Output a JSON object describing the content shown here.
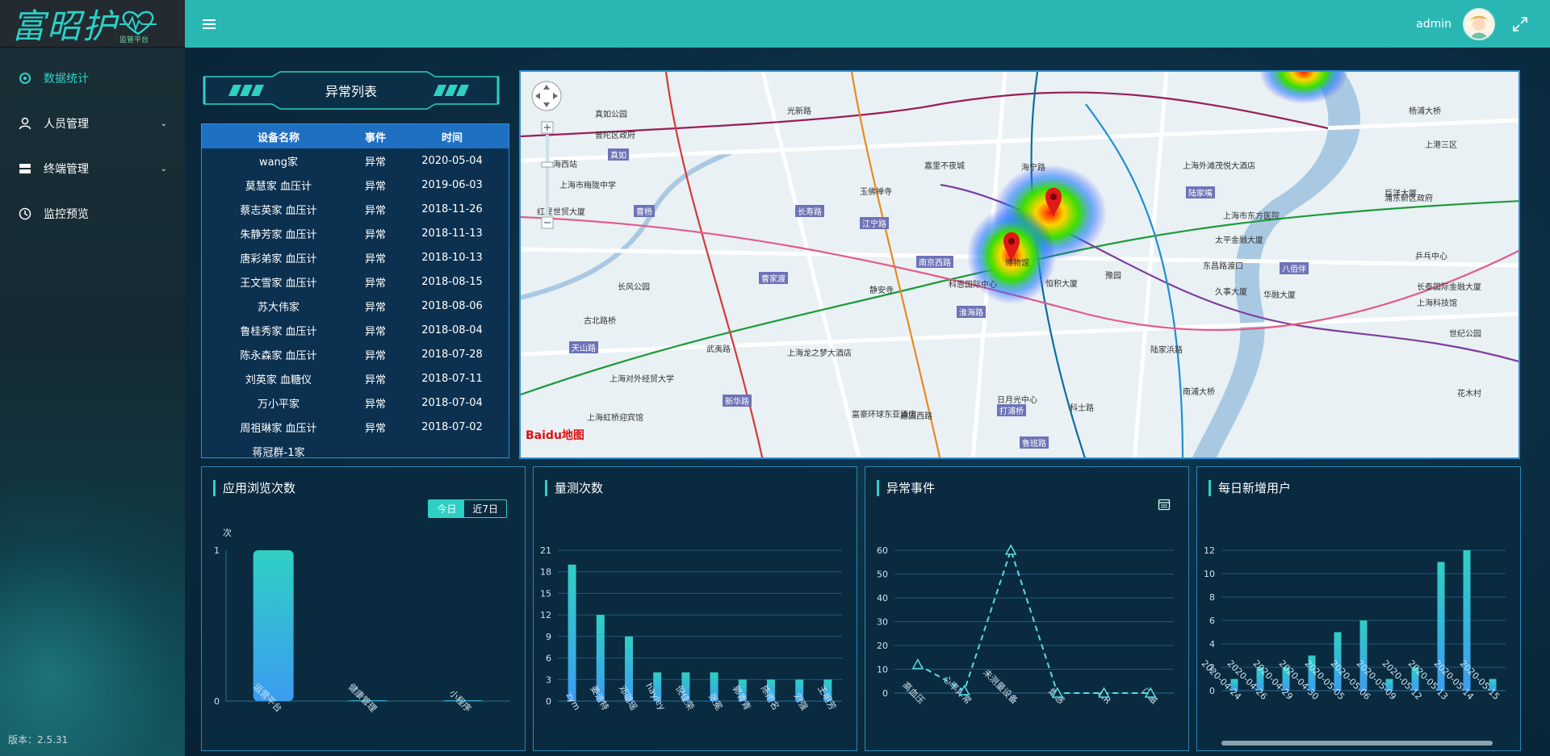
{
  "app": {
    "logo_text": "富昭护",
    "logo_sub": "监管平台",
    "version": "版本：2.5.31"
  },
  "sidebar": {
    "items": [
      {
        "label": "数据统计",
        "icon": "dashboard-icon",
        "active": true
      },
      {
        "label": "人员管理",
        "icon": "user-icon",
        "expandable": true
      },
      {
        "label": "终端管理",
        "icon": "device-icon",
        "expandable": true
      },
      {
        "label": "监控预览",
        "icon": "clock-icon"
      }
    ]
  },
  "header": {
    "username": "admin"
  },
  "abnormal_list": {
    "title": "异常列表",
    "columns": [
      "设备名称",
      "事件",
      "时间"
    ],
    "rows": [
      {
        "name": "wang家",
        "event": "异常",
        "time": "2020-05-04"
      },
      {
        "name": "莫慧家 血压计",
        "event": "异常",
        "time": "2019-06-03"
      },
      {
        "name": "蔡志英家 血压计",
        "event": "异常",
        "time": "2018-11-26"
      },
      {
        "name": "朱静芳家 血压计",
        "event": "异常",
        "time": "2018-11-13"
      },
      {
        "name": "唐彩弟家 血压计",
        "event": "异常",
        "time": "2018-10-13"
      },
      {
        "name": "王文雪家 血压计",
        "event": "异常",
        "time": "2018-08-15"
      },
      {
        "name": "苏大伟家",
        "event": "异常",
        "time": "2018-08-06"
      },
      {
        "name": "鲁桂秀家 血压计",
        "event": "异常",
        "time": "2018-08-04"
      },
      {
        "name": "陈永森家 血压计",
        "event": "异常",
        "time": "2018-07-28"
      },
      {
        "name": "刘英家 血糖仪",
        "event": "异常",
        "time": "2018-07-11"
      },
      {
        "name": "万小平家",
        "event": "异常",
        "time": "2018-07-04"
      },
      {
        "name": "周祖琳家 血压计",
        "event": "异常",
        "time": "2018-07-02"
      },
      {
        "name": "蒋冠群-1家",
        "event": "",
        "time": ""
      }
    ]
  },
  "map": {
    "places": [
      {
        "text": "真如公园"
      },
      {
        "text": "普陀区政府"
      },
      {
        "text": "真如"
      },
      {
        "text": "上海西站"
      },
      {
        "text": "上海市梅陇中学"
      },
      {
        "text": "红星世贸大厦"
      },
      {
        "text": "曹杨"
      },
      {
        "text": "长寿路"
      },
      {
        "text": "江宁路"
      },
      {
        "text": "玉佛禅寺"
      },
      {
        "text": "光新路"
      },
      {
        "text": "曹家渡"
      },
      {
        "text": "长风公园"
      },
      {
        "text": "静安寺"
      },
      {
        "text": "南京西路"
      },
      {
        "text": "科恩国际中心"
      },
      {
        "text": "淮海路"
      },
      {
        "text": "古北路桥"
      },
      {
        "text": "天山路"
      },
      {
        "text": "武夷路"
      },
      {
        "text": "上海龙之梦大酒店"
      },
      {
        "text": "上海对外经贸大学"
      },
      {
        "text": "新华路"
      },
      {
        "text": "上海虹桥迎宾馆"
      },
      {
        "text": "富豪环球东亚酒店"
      },
      {
        "text": "建国西路"
      },
      {
        "text": "日月光中心"
      },
      {
        "text": "打浦桥"
      },
      {
        "text": "鲁班路"
      },
      {
        "text": "科士路"
      },
      {
        "text": "海宁路"
      },
      {
        "text": "嘉里不夜城"
      },
      {
        "text": "上海外滩茂悦大酒店"
      },
      {
        "text": "陆家嘴"
      },
      {
        "text": "上海市东方医院"
      },
      {
        "text": "太平金融大厦"
      },
      {
        "text": "东昌路渡口"
      },
      {
        "text": "八佰伴"
      },
      {
        "text": "华融大厦"
      },
      {
        "text": "久事大厦"
      },
      {
        "text": "浦东新区政府"
      },
      {
        "text": "上海科技馆"
      },
      {
        "text": "世纪公园"
      },
      {
        "text": "杨浦大桥"
      },
      {
        "text": "上港三区"
      },
      {
        "text": "巨洋大厦"
      },
      {
        "text": "乒乓中心"
      },
      {
        "text": "长泰国际金融大厦"
      },
      {
        "text": "南浦大桥"
      },
      {
        "text": "陆家浜路"
      },
      {
        "text": "花木村"
      },
      {
        "text": "博物馆"
      },
      {
        "text": "恒积大厦"
      },
      {
        "text": "豫园"
      }
    ],
    "logo": "Baidu地图"
  },
  "cards": {
    "browse": {
      "title": "应用浏览次数",
      "seg_today": "今日",
      "seg_7d": "近7日"
    },
    "measure": {
      "title": "量测次数"
    },
    "abnormal": {
      "title": "异常事件"
    },
    "newusers": {
      "title": "每日新增用户"
    }
  },
  "chart_data": [
    {
      "type": "bar",
      "title": "应用浏览次数",
      "ylabel": "次",
      "categories": [
        "运营平台",
        "健康管理",
        "小程序"
      ],
      "values": [
        1,
        0,
        0
      ],
      "ylim": [
        0,
        1
      ],
      "yticks": [
        "0",
        "1"
      ]
    },
    {
      "type": "bar",
      "title": "量测次数",
      "categories": [
        "zym",
        "姜浩特",
        "邓璐瑶",
        "hayley",
        "倪佳荣",
        "张冕",
        "郭青青",
        "陈雨名",
        "刘强",
        "王明芳"
      ],
      "values": [
        19,
        12,
        9,
        4,
        4,
        4,
        3,
        3,
        3,
        3
      ],
      "ylim": [
        0,
        21
      ],
      "yticks": [
        "0",
        "3",
        "6",
        "9",
        "12",
        "15",
        "18",
        "21"
      ]
    },
    {
      "type": "line",
      "title": "异常事件",
      "categories": [
        "高血压",
        "心率异常",
        "未测量设备",
        "烟感",
        "PIR",
        "门磁"
      ],
      "values": [
        12,
        1,
        60,
        0,
        0,
        0
      ],
      "ylim": [
        0,
        60
      ],
      "yticks": [
        "0",
        "10",
        "20",
        "30",
        "40",
        "50",
        "60"
      ]
    },
    {
      "type": "bar",
      "title": "每日新增用户",
      "categories": [
        "2020-04-24",
        "2020-04-26",
        "2020-04-29",
        "2020-04-30",
        "2020-05-05",
        "2020-05-06",
        "2020-05-09",
        "2020-05-12",
        "2020-05-13",
        "2020-05-14",
        "2020-05-15"
      ],
      "values": [
        1,
        2,
        2,
        3,
        5,
        6,
        1,
        2,
        11,
        12,
        1
      ],
      "ylim": [
        0,
        12
      ],
      "yticks": [
        "0",
        "2",
        "4",
        "6",
        "8",
        "10",
        "12"
      ]
    }
  ],
  "colors": {
    "accent": "#2ab7b3",
    "bar_top": "#2fd0c4",
    "bar_bottom": "#3b9cf0",
    "panel_border": "#2e86b8"
  }
}
